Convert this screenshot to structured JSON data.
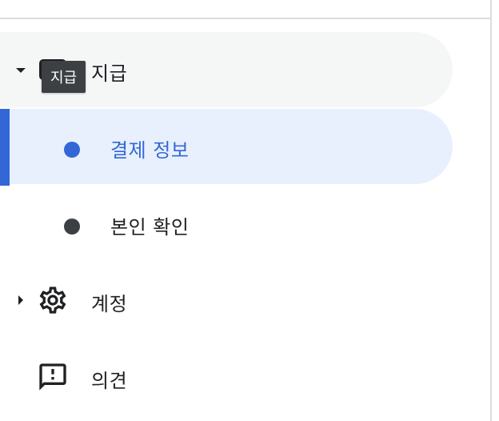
{
  "nav": {
    "payments": {
      "label": "지급",
      "expanded": true,
      "icon": "payments-card-icon"
    },
    "payment_info": {
      "label": "결제 정보",
      "active": true,
      "icon": "bullet-dot-icon"
    },
    "identity": {
      "label": "본인 확인",
      "icon": "bullet-dot-icon"
    },
    "account": {
      "label": "계정",
      "expanded": false,
      "icon": "gear-icon"
    },
    "feedback": {
      "label": "의견",
      "icon": "feedback-icon"
    }
  },
  "tooltip": {
    "text": "지급"
  },
  "colors": {
    "accent": "#3367d6",
    "active_bg": "#e8f0fe",
    "hover_bg": "#f5f6f6",
    "text": "#202124",
    "tooltip_bg": "#3c4043"
  }
}
